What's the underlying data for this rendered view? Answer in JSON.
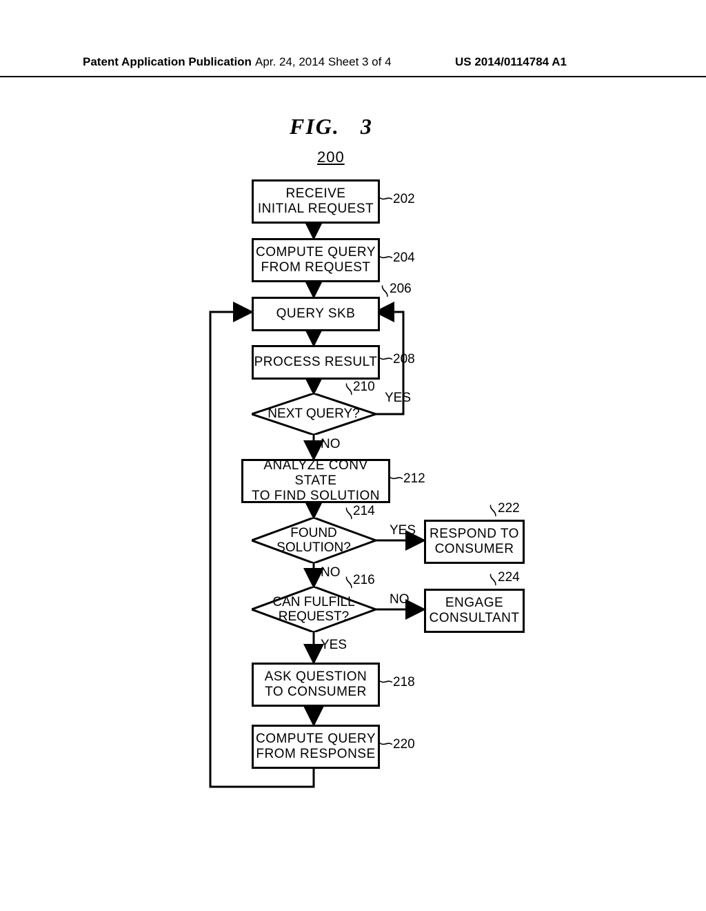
{
  "header": {
    "left": "Patent Application Publication",
    "center": "Apr. 24, 2014  Sheet 3 of 4",
    "right": "US 2014/0114784 A1"
  },
  "figure": {
    "title_prefix": "FIG.",
    "title_num": "3",
    "ref": "200"
  },
  "nodes": {
    "n202": {
      "line1": "RECEIVE",
      "line2": "INITIAL REQUEST",
      "ref": "202"
    },
    "n204": {
      "line1": "COMPUTE QUERY",
      "line2": "FROM REQUEST",
      "ref": "204"
    },
    "n206": {
      "line1": "QUERY SKB",
      "ref": "206"
    },
    "n208": {
      "line1": "PROCESS RESULT",
      "ref": "208"
    },
    "n210": {
      "line1": "NEXT QUERY?",
      "ref": "210",
      "yes": "YES",
      "no": "NO"
    },
    "n212": {
      "line1": "ANALYZE CONV STATE",
      "line2": "TO FIND SOLUTION",
      "ref": "212"
    },
    "n214": {
      "line1": "FOUND",
      "line2": "SOLUTION?",
      "ref": "214",
      "yes": "YES",
      "no": "NO"
    },
    "n216": {
      "line1": "CAN FULFILL",
      "line2": "REQUEST?",
      "ref": "216",
      "yes": "YES",
      "no": "NO"
    },
    "n218": {
      "line1": "ASK QUESTION",
      "line2": "TO CONSUMER",
      "ref": "218"
    },
    "n220": {
      "line1": "COMPUTE QUERY",
      "line2": "FROM RESPONSE",
      "ref": "220"
    },
    "n222": {
      "line1": "RESPOND TO",
      "line2": "CONSUMER",
      "ref": "222"
    },
    "n224": {
      "line1": "ENGAGE",
      "line2": "CONSULTANT",
      "ref": "224"
    }
  }
}
